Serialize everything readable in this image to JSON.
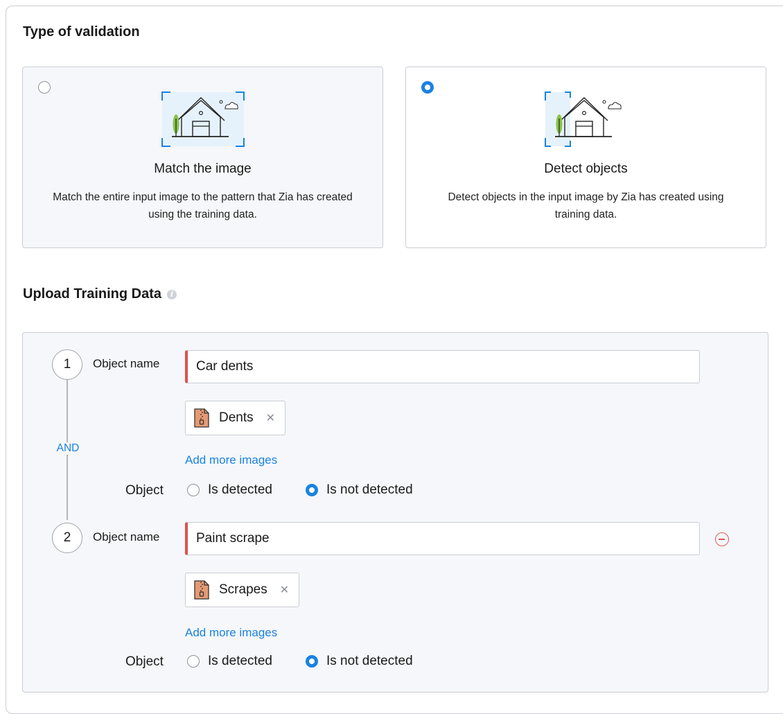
{
  "validation": {
    "title": "Type of validation",
    "cards": [
      {
        "title": "Match the image",
        "description": "Match the entire input image to the pattern that Zia has created using the training data.",
        "selected": false
      },
      {
        "title": "Detect objects",
        "description": "Detect objects in the input image by Zia has created using training data.",
        "selected": true
      }
    ]
  },
  "training": {
    "title": "Upload Training Data",
    "info_icon": "info-icon",
    "connector": "AND",
    "object_label": "Object name",
    "add_more_label": "Add more images",
    "condition_label": "Object",
    "option_detected": "Is detected",
    "option_not_detected": "Is not detected",
    "objects": [
      {
        "number": "1",
        "name": "Car dents",
        "file": "Dents",
        "file_icon": "zip-file-icon",
        "condition": "Is not detected"
      },
      {
        "number": "2",
        "name": "Paint scrape",
        "file": "Scrapes",
        "file_icon": "zip-file-icon",
        "condition": "Is not detected",
        "remove_icon": "remove-circle-icon"
      }
    ]
  },
  "colors": {
    "accent": "#1a82e2",
    "required": "#d9534f",
    "remove": "#e05a5a",
    "box_bg": "#f5f7fa",
    "border": "#c9cdd3"
  }
}
